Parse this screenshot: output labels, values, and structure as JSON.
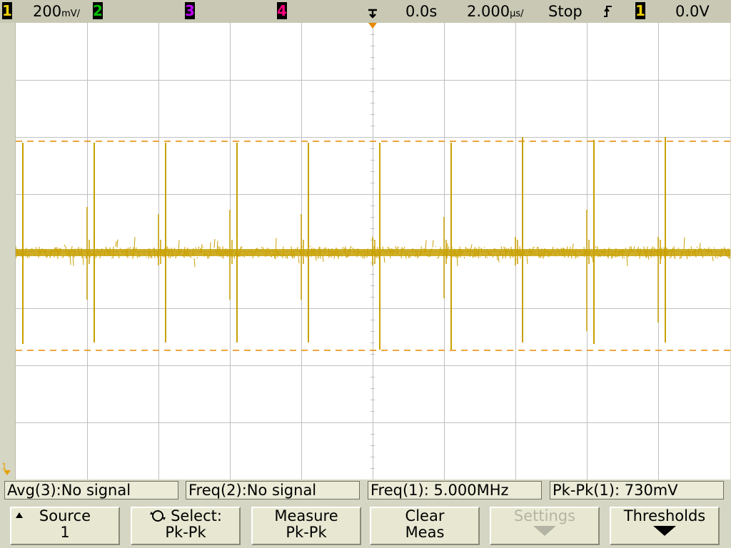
{
  "status": {
    "ch1_label": "1",
    "ch1_scale": "200",
    "ch1_unit": "mV/",
    "ch2_label": "2",
    "ch3_label": "3",
    "ch4_label": "4",
    "time_delay": "0.0s",
    "time_scale": "2.000",
    "time_unit": "µs/",
    "run_state": "Stop",
    "trigger_source": "1",
    "trigger_level": "0.0V"
  },
  "colors": {
    "ch1": "#f0d000",
    "ch2": "#00c000",
    "ch3": "#c000ff",
    "ch4": "#ff0080",
    "trace": "#c8a000",
    "cursor": "#e88800"
  },
  "icons": {
    "trigger_mark": "trigger-position-icon",
    "slope": "rising-edge-icon",
    "ground": "ground-marker-icon"
  },
  "ground_marker": "1",
  "measurements": [
    {
      "label": "Avg(3):No signal"
    },
    {
      "label": "Freq(2):No signal"
    },
    {
      "label": "Freq(1): 5.000MHz"
    },
    {
      "label": "Pk-Pk(1): 730mV"
    }
  ],
  "softkeys": [
    {
      "line1": "Source",
      "line2": "1"
    },
    {
      "line1": "Select:",
      "line2": "Pk-Pk"
    },
    {
      "line1": "Measure",
      "line2": "Pk-Pk"
    },
    {
      "line1": "Clear",
      "line2": "Meas"
    },
    {
      "line1": "Settings",
      "line2": ""
    },
    {
      "line1": "Thresholds",
      "line2": ""
    }
  ]
}
